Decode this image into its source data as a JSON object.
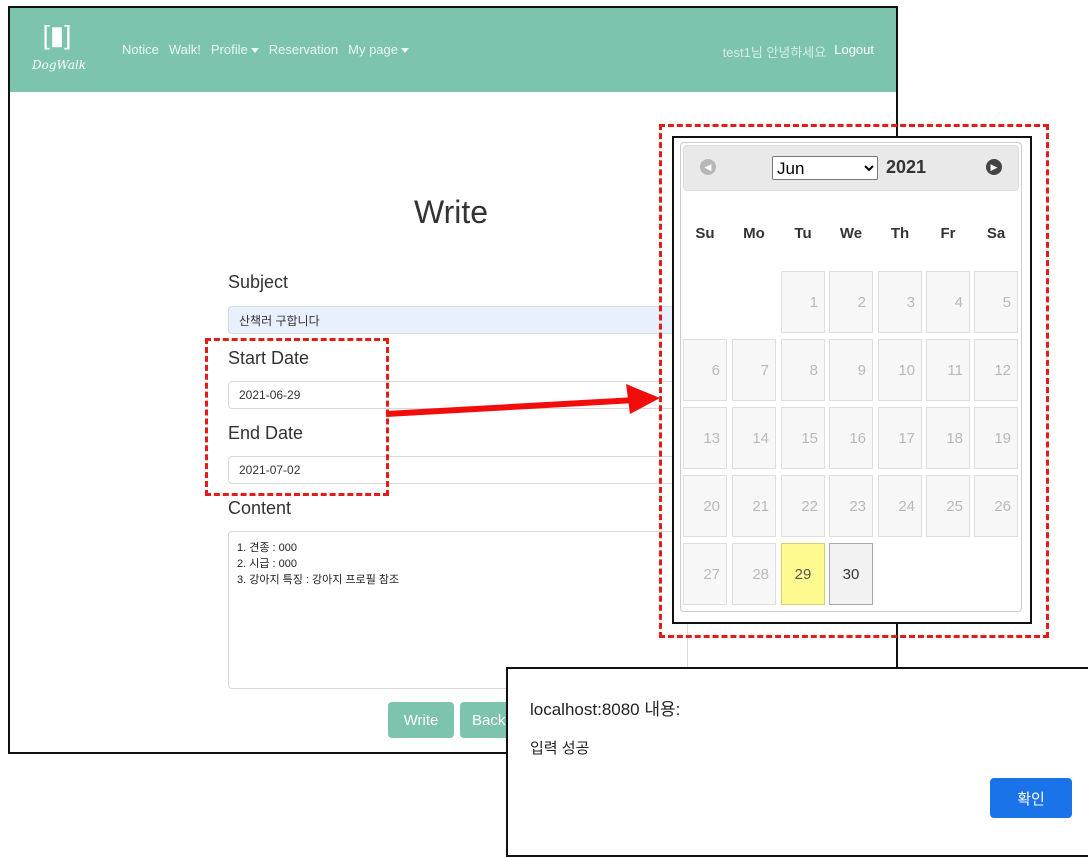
{
  "navbar": {
    "brand": "DogWalk",
    "items": [
      {
        "label": "Notice",
        "dropdown": false
      },
      {
        "label": "Walk!",
        "dropdown": false
      },
      {
        "label": "Profile",
        "dropdown": true
      },
      {
        "label": "Reservation",
        "dropdown": false
      },
      {
        "label": "My page",
        "dropdown": true
      }
    ],
    "greeting": "test1님 안녕하세요",
    "logout": "Logout",
    "color": "#7cc4ae"
  },
  "form": {
    "title": "Write",
    "subject_label": "Subject",
    "subject_value": "산책러 구합니다",
    "start_label": "Start Date",
    "start_value": "2021-06-29",
    "end_label": "End Date",
    "end_value": "2021-07-02",
    "content_label": "Content",
    "content_lines": [
      "1. 견종 : 000",
      "2. 시급 : 000",
      "3. 강아지 특징 : 강아지 프로필 참조"
    ],
    "write_button": "Write",
    "back_button": "Back"
  },
  "calendar": {
    "month": "Jun",
    "year": "2021",
    "weekdays": [
      "Su",
      "Mo",
      "Tu",
      "We",
      "Th",
      "Fr",
      "Sa"
    ],
    "first_weekday_index": 2,
    "days_in_month": 30,
    "today": 29,
    "highlighted": 30
  },
  "dialog": {
    "title": "localhost:8080 내용:",
    "message": "입력 성공",
    "ok_button": "확인",
    "ok_color": "#1a73e8"
  },
  "annotation": {
    "color": "#e31b1b"
  }
}
